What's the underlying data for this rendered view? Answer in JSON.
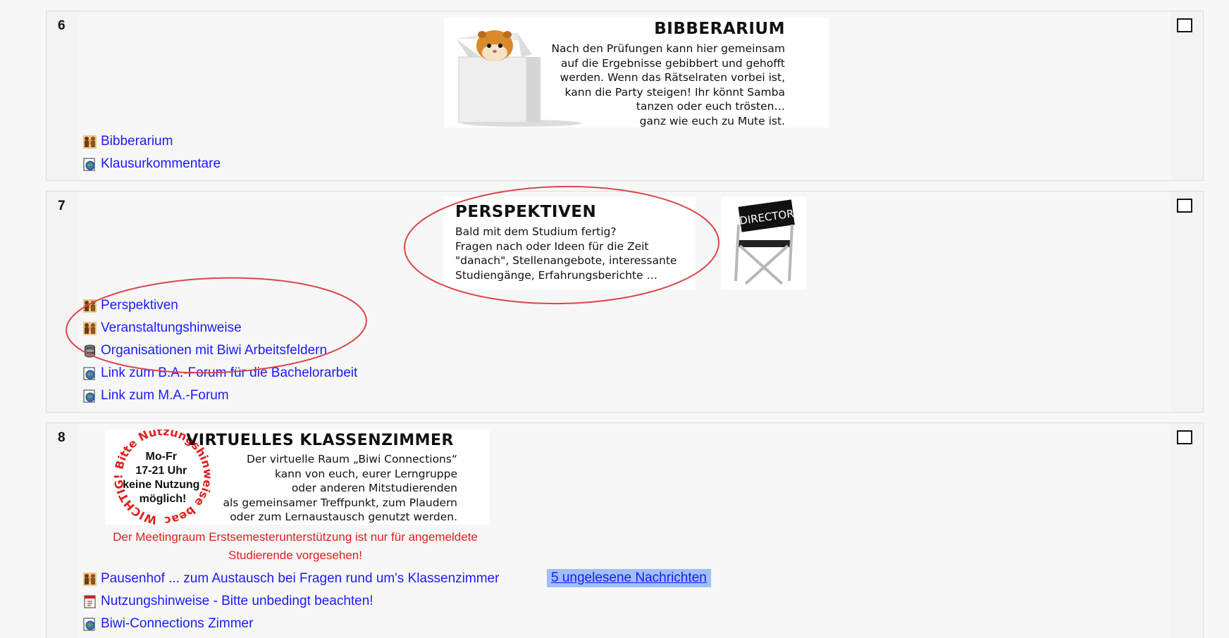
{
  "sections": [
    {
      "number": "6",
      "banner": {
        "title": "BIBBERARIUM",
        "lines": [
          "Nach den Prüfungen kann hier gemeinsam",
          "auf die Ergebnisse gebibbert und gehofft",
          "werden. Wenn das Rätselraten vorbei ist,",
          "kann die Party steigen! Ihr könnt Samba",
          "tanzen oder euch trösten…",
          "ganz wie euch zu Mute ist."
        ]
      },
      "activities": [
        {
          "label": "Bibberarium",
          "icon": "forum-icon"
        },
        {
          "label": "Klausurkommentare",
          "icon": "url-icon"
        }
      ]
    },
    {
      "number": "7",
      "banner": {
        "title": "PERSPEKTIVEN",
        "lines": [
          "Bald mit dem Studium fertig?",
          "Fragen nach oder Ideen für die Zeit",
          "\"danach\", Stellenangebote, interessante",
          "Studiengänge, Erfahrungsberichte …"
        ],
        "chair_label": "DIRECTOR"
      },
      "activities": [
        {
          "label": "Perspektiven",
          "icon": "forum-icon"
        },
        {
          "label": "Veranstaltungshinweise",
          "icon": "forum-icon"
        },
        {
          "label": "Organisationen mit Biwi Arbeitsfeldern",
          "icon": "database-icon"
        },
        {
          "label": "Link zum B.A.-Forum für die Bachelorarbeit",
          "icon": "url-icon"
        },
        {
          "label": "Link zum M.A.-Forum",
          "icon": "url-icon"
        }
      ]
    },
    {
      "number": "8",
      "banner": {
        "title": "VIRTUELLES KLASSENZIMMER",
        "lines": [
          "Der virtuelle Raum „Biwi Connections“",
          "kann von euch, eurer Lerngruppe",
          "oder anderen Mitstudierenden",
          "als gemeinsamer Treffpunkt, zum Plaudern",
          "oder zum Lernaustausch genutzt werden."
        ],
        "stamp": {
          "ring_text": "WICHTIG! Bitte Nutzungshinweise beachten!",
          "center_lines": [
            "Mo-Fr",
            "17-21 Uhr",
            "keine Nutzung",
            "möglich!"
          ]
        }
      },
      "notice_lines": [
        "Der Meetingraum Erstsemesterunterstützung ist nur für angemeldete",
        "Studierende vorgesehen!"
      ],
      "activities": [
        {
          "label": "Pausenhof ... zum Austausch bei Fragen rund um's Klassenzimmer",
          "icon": "forum-icon"
        },
        {
          "label": "Nutzungshinweise - Bitte unbedingt beachten!",
          "icon": "pdf-icon"
        },
        {
          "label": "Biwi-Connections Zimmer",
          "icon": "url-icon"
        }
      ],
      "unread_badge": "5 ungelesene Nachrichten"
    }
  ],
  "colors": {
    "link": "#1a1aff",
    "notice": "#e0201c",
    "annotation": "#d9474a",
    "badge_bg": "#9fbff5"
  }
}
